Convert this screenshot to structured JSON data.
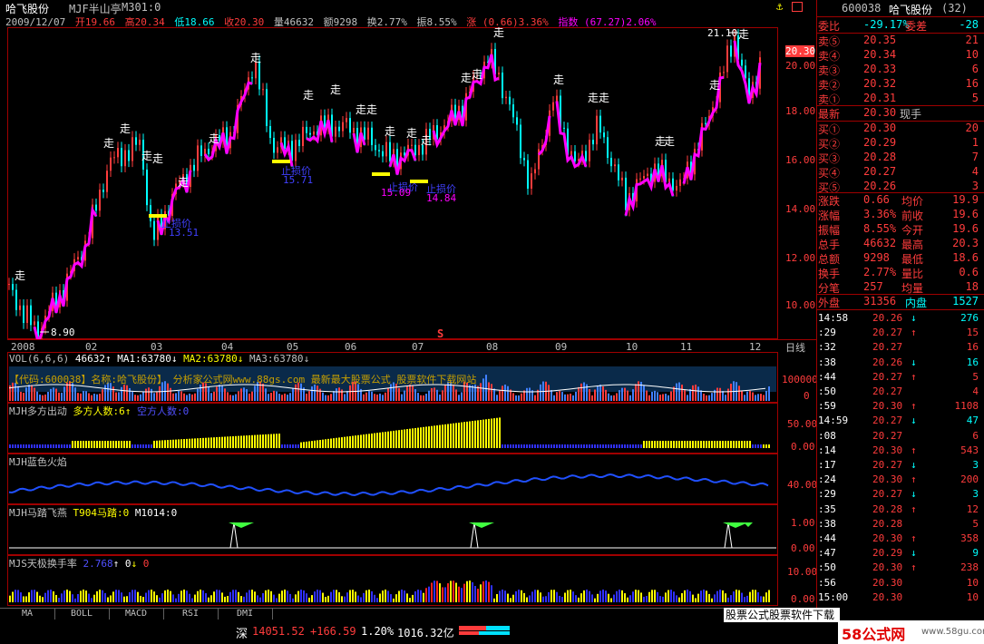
{
  "title_bar": {
    "stock_name": "哈飞股份",
    "formula": "MJF半山亭",
    "chart_period": "M301:0"
  },
  "info_bar": {
    "date": "2009/12/07",
    "open": "开19.66",
    "high": "高20.34",
    "low": "低18.66",
    "close": "收20.30",
    "volume": "量46632",
    "amount": "额9298",
    "turnover": "换2.77%",
    "amplitude": "振8.55%",
    "change": "涨 (0.66)3.36%",
    "index": "指数 (67.27)2.06%"
  },
  "main_chart": {
    "y_ticks": [
      "20.00",
      "18.00",
      "16.00",
      "14.00",
      "12.00",
      "10.00"
    ],
    "x_ticks": [
      "2008",
      "02",
      "03",
      "04",
      "05",
      "06",
      "07",
      "08",
      "09",
      "10",
      "11",
      "12"
    ],
    "period_label": "日线",
    "high_label": "21.10",
    "low_label": "8.90",
    "current_price": "20.30",
    "zou_label": "走",
    "signal_s": "S",
    "annotations": [
      {
        "text": "止损价",
        "color": "#4040ff"
      },
      {
        "text": "13.51",
        "color": "#4040ff"
      },
      {
        "text": "止损价",
        "color": "#4040ff"
      },
      {
        "text": "15.71",
        "color": "#4040ff"
      },
      {
        "text": "止损价",
        "color": "#4040ff"
      },
      {
        "text": "15.09",
        "color": "#ff00ff"
      },
      {
        "text": "止损价",
        "color": "#4040ff"
      },
      {
        "text": "14.84",
        "color": "#ff00ff"
      }
    ]
  },
  "vol_panel": {
    "title": "VOL(6,6,6)",
    "v1": "46632",
    "ma1": "MA1:63780",
    "ma2": "MA2:63780",
    "ma3": "MA3:63780",
    "y_tick": "100000",
    "y_tick0": "0",
    "watermark": "【代码:600038】名称:哈飞股份】        分析家公式网www.88gs.com 最新最大股票公式 股票软件下载网站"
  },
  "duo_panel": {
    "title": "MJH多方出动",
    "label1": "多方人数:6",
    "label2": "空方人数:0",
    "y_ticks": [
      "50.00",
      "0.00"
    ]
  },
  "blue_panel": {
    "title": "MJH蓝色火焰",
    "y_ticks": [
      "40.00"
    ]
  },
  "horse_panel": {
    "title": "MJH马踏飞燕",
    "label1": "T904马踏:0",
    "label2": "M1014:0",
    "y_ticks": [
      "1.00",
      "0.00"
    ]
  },
  "turn_panel": {
    "title": "MJS天极换手率",
    "v1": "2.768",
    "v2": "0",
    "v3": "0",
    "y_ticks": [
      "10.00",
      "0.00"
    ]
  },
  "quote": {
    "code": "600038",
    "name": "哈飞股份",
    "count": "(32)",
    "ratio_label": "委比",
    "ratio_value": "-29.17%",
    "diff_label": "委差",
    "diff_value": "-28",
    "sells": [
      {
        "label": "卖⑤",
        "price": "20.35",
        "vol": "21"
      },
      {
        "label": "卖④",
        "price": "20.34",
        "vol": "10"
      },
      {
        "label": "卖③",
        "price": "20.33",
        "vol": "6"
      },
      {
        "label": "卖②",
        "price": "20.32",
        "vol": "16"
      },
      {
        "label": "卖①",
        "price": "20.31",
        "vol": "5"
      }
    ],
    "latest_label": "最新",
    "latest_price": "20.30",
    "now_hand_label": "现手",
    "buys": [
      {
        "label": "买①",
        "price": "20.30",
        "vol": "20"
      },
      {
        "label": "买②",
        "price": "20.29",
        "vol": "1"
      },
      {
        "label": "买③",
        "price": "20.28",
        "vol": "7"
      },
      {
        "label": "买④",
        "price": "20.27",
        "vol": "4"
      },
      {
        "label": "买⑤",
        "price": "20.26",
        "vol": "3"
      }
    ],
    "stats": [
      {
        "l1": "涨跌",
        "v1": "0.66",
        "l2": "均价",
        "v2": "19.9"
      },
      {
        "l1": "涨幅",
        "v1": "3.36%",
        "l2": "前收",
        "v2": "19.6"
      },
      {
        "l1": "振幅",
        "v1": "8.55%",
        "l2": "今开",
        "v2": "19.6"
      },
      {
        "l1": "总手",
        "v1": "46632",
        "l2": "最高",
        "v2": "20.3"
      },
      {
        "l1": "总额",
        "v1": "9298",
        "l2": "最低",
        "v2": "18.6"
      },
      {
        "l1": "换手",
        "v1": "2.77%",
        "l2": "量比",
        "v2": "0.6"
      },
      {
        "l1": "分笔",
        "v1": "257",
        "l2": "均量",
        "v2": "18"
      }
    ],
    "outer_label": "外盘",
    "outer_value": "31356",
    "inner_label": "内盘",
    "inner_value": "1527"
  },
  "ticks": [
    {
      "t": "14:58",
      "p": "20.26",
      "d": "down",
      "v": "276"
    },
    {
      "t": ":29",
      "p": "20.27",
      "d": "up",
      "v": "15"
    },
    {
      "t": ":32",
      "p": "20.27",
      "d": "",
      "v": "16"
    },
    {
      "t": ":38",
      "p": "20.26",
      "d": "down",
      "v": "16"
    },
    {
      "t": ":44",
      "p": "20.27",
      "d": "up",
      "v": "5"
    },
    {
      "t": ":50",
      "p": "20.27",
      "d": "",
      "v": "4"
    },
    {
      "t": ":59",
      "p": "20.30",
      "d": "up",
      "v": "1108"
    },
    {
      "t": "14:59",
      "p": "20.27",
      "d": "down",
      "v": "47"
    },
    {
      "t": ":08",
      "p": "20.27",
      "d": "",
      "v": "6"
    },
    {
      "t": ":14",
      "p": "20.30",
      "d": "up",
      "v": "543"
    },
    {
      "t": ":17",
      "p": "20.27",
      "d": "down",
      "v": "3"
    },
    {
      "t": ":24",
      "p": "20.30",
      "d": "up",
      "v": "200"
    },
    {
      "t": ":29",
      "p": "20.27",
      "d": "down",
      "v": "3"
    },
    {
      "t": ":35",
      "p": "20.28",
      "d": "up",
      "v": "12"
    },
    {
      "t": ":38",
      "p": "20.28",
      "d": "",
      "v": "5"
    },
    {
      "t": ":44",
      "p": "20.30",
      "d": "up",
      "v": "358"
    },
    {
      "t": ":47",
      "p": "20.29",
      "d": "down",
      "v": "9"
    },
    {
      "t": ":50",
      "p": "20.30",
      "d": "up",
      "v": "238"
    },
    {
      "t": ":56",
      "p": "20.30",
      "d": "",
      "v": "10"
    },
    {
      "t": "15:00",
      "p": "20.30",
      "d": "",
      "v": "10"
    }
  ],
  "bottom_tabs": [
    "MA",
    "BOLL",
    "MACD",
    "RSI",
    "DMI"
  ],
  "status_bar": {
    "market": "深",
    "index_value": "14051.52",
    "index_change": "+166.59",
    "index_pct": "1.20%",
    "amount": "1016.32亿",
    "ad_text": "股票公式股票软件下载",
    "site_text": "58公式网",
    "site_url": "www.58gu.com"
  },
  "colors": {
    "up": "#ff3c3c",
    "down": "#00ffff",
    "trend": "#ff00ff",
    "bar_yellow": "#ffff00",
    "bar_blue": "#3030ff",
    "frame": "#a00000"
  }
}
